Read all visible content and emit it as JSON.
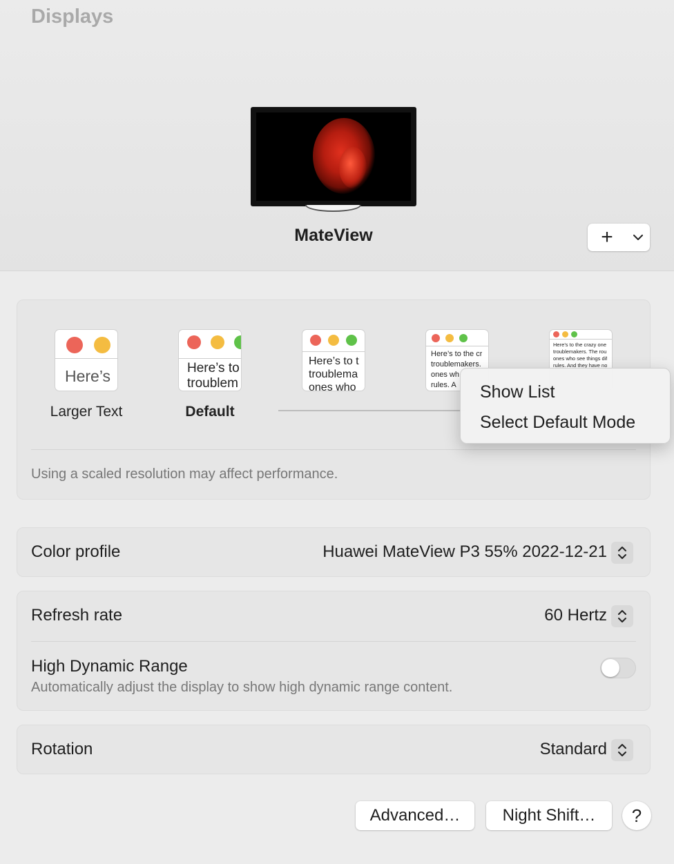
{
  "window": {
    "title": "Displays"
  },
  "display": {
    "name": "MateView"
  },
  "add_control": {
    "plus": "+",
    "chevron_icon": "chevron-down-icon"
  },
  "resolution": {
    "options": [
      {
        "label": "Larger Text",
        "preview": "Here’s"
      },
      {
        "label": "Default",
        "preview_line1": "Here’s to",
        "preview_line2": "troublem"
      },
      {
        "preview_line1": "Here’s to t",
        "preview_line2": "troublema",
        "preview_line3": "ones who"
      },
      {
        "preview_line1": "Here’s to the cr",
        "preview_line2": "troublemakers.",
        "preview_line3": "ones wh",
        "preview_line4": "rules. A"
      },
      {
        "preview_line1": "Here’s to the crazy one",
        "preview_line2": "troublemakers. The rou",
        "preview_line3": "ones who see things dif",
        "preview_line4": "rules. And they have no"
      }
    ],
    "selected": "Default",
    "note": "Using a scaled resolution may affect performance."
  },
  "context_menu": {
    "items": [
      "Show List",
      "Select Default Mode"
    ]
  },
  "color_profile": {
    "label": "Color profile",
    "value": "Huawei MateView P3 55% 2022-12-21"
  },
  "refresh_rate": {
    "label": "Refresh rate",
    "value": "60 Hertz"
  },
  "hdr": {
    "label": "High Dynamic Range",
    "description": "Automatically adjust the display to show high dynamic range content.",
    "enabled": false
  },
  "rotation": {
    "label": "Rotation",
    "value": "Standard"
  },
  "buttons": {
    "advanced": "Advanced…",
    "night_shift": "Night Shift…",
    "help": "?"
  },
  "colors": {
    "traffic_red": "#ec6559",
    "traffic_yellow": "#f4bc41",
    "traffic_green": "#5fc249"
  }
}
